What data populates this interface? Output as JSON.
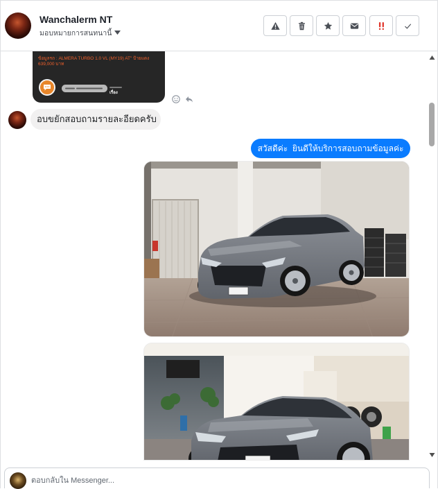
{
  "header": {
    "contact_name": "Wanchalerm NT",
    "assign_label": "มอบหมายการสนทนานี้",
    "actions": [
      {
        "icon": "warning-icon"
      },
      {
        "icon": "trash-icon"
      },
      {
        "icon": "star-icon"
      },
      {
        "icon": "envelope-icon"
      },
      {
        "icon": "spam-icon",
        "color": "#e0352b"
      },
      {
        "icon": "check-icon"
      }
    ]
  },
  "conversation": {
    "shared_card": {
      "details": "ข้อมูลรถ : ALMERA TURBO 1.0 VL (MY19) AT\" ป้ายแดง",
      "price": "639,000 บาท",
      "topic": "เรื่อง",
      "accent_color": "#f0602c"
    },
    "reactions": [
      "smiley-icon",
      "reply-icon"
    ],
    "incoming": {
      "text": "อบขยักสอบถามรายละอียดครับ",
      "bubble_color": "#f1f0f0"
    },
    "outgoing": {
      "text": "สวัสดีค่ะ  ยินดีให้บริการสอบถามข้อมูลค่ะ",
      "bubble_color": "#0a7cff"
    }
  },
  "composer": {
    "placeholder": "ตอบกลับใน Messenger..."
  }
}
